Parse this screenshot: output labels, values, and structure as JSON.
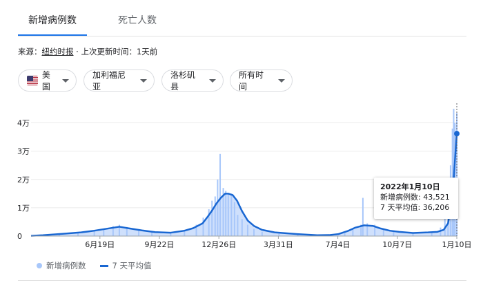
{
  "tabs": [
    {
      "label": "新增病例数",
      "active": true
    },
    {
      "label": "死亡人数",
      "active": false
    }
  ],
  "source": {
    "prefix": "来源：",
    "link": "纽约时报",
    "suffix": " · 上次更新时间：1天前"
  },
  "filters": {
    "country": "美国",
    "state": "加利福尼亚",
    "county": "洛杉矶县",
    "time": "所有时间"
  },
  "tooltip": {
    "date": "2022年1月10日",
    "new_cases": "新增病例数: 43,521",
    "avg": "7 天平均值: 36,206"
  },
  "legend": {
    "bars": "新增病例数",
    "line": "7 天平均值"
  },
  "colors": {
    "accent": "#1a73e8",
    "bars": "#a8c7fa",
    "line": "#1967d2"
  },
  "chart_data": {
    "type": "bar",
    "y_tick_labels": [
      "0",
      "1万",
      "2万",
      "3万",
      "4万"
    ],
    "x_tick_labels": [
      "6月19日",
      "9月22日",
      "12月26日",
      "3月31日",
      "7月4日",
      "10月7日",
      "1月10日"
    ],
    "ylim": [
      0,
      45000
    ],
    "series": [
      {
        "name": "新增病例数",
        "type": "bar",
        "x": [
          "2020-03-15",
          "2020-04-15",
          "2020-05-15",
          "2020-06-10",
          "2020-06-25",
          "2020-07-10",
          "2020-07-20",
          "2020-08-01",
          "2020-08-20",
          "2020-09-10",
          "2020-10-10",
          "2020-11-01",
          "2020-11-20",
          "2020-12-01",
          "2020-12-10",
          "2020-12-15",
          "2020-12-20",
          "2020-12-24",
          "2020-12-28",
          "2021-01-02",
          "2021-01-06",
          "2021-01-10",
          "2021-01-15",
          "2021-01-20",
          "2021-01-25",
          "2021-02-01",
          "2021-02-10",
          "2021-02-20",
          "2021-03-05",
          "2021-04-01",
          "2021-05-01",
          "2021-06-01",
          "2021-06-25",
          "2021-07-15",
          "2021-07-28",
          "2021-08-10",
          "2021-08-13",
          "2021-08-20",
          "2021-09-01",
          "2021-09-15",
          "2021-10-01",
          "2021-11-01",
          "2021-12-01",
          "2021-12-15",
          "2021-12-22",
          "2021-12-27",
          "2021-12-31",
          "2022-01-03",
          "2022-01-05",
          "2022-01-07",
          "2022-01-10"
        ],
        "values": [
          300,
          800,
          1200,
          1800,
          2500,
          3500,
          4000,
          3200,
          2300,
          1500,
          1300,
          2200,
          4000,
          6500,
          9500,
          12500,
          14000,
          20000,
          29000,
          17000,
          16000,
          15000,
          15000,
          12000,
          7500,
          6000,
          4000,
          2500,
          1500,
          800,
          500,
          300,
          400,
          1000,
          2500,
          4000,
          13500,
          4500,
          4000,
          2500,
          1800,
          1200,
          1500,
          3000,
          7000,
          17000,
          25000,
          38000,
          45000,
          40000,
          43521
        ]
      },
      {
        "name": "7 天平均值",
        "type": "line",
        "x": [
          "2020-03-01",
          "2020-03-20",
          "2020-04-20",
          "2020-05-20",
          "2020-06-10",
          "2020-06-30",
          "2020-07-20",
          "2020-08-05",
          "2020-08-25",
          "2020-09-15",
          "2020-10-10",
          "2020-11-01",
          "2020-11-15",
          "2020-11-30",
          "2020-12-08",
          "2020-12-15",
          "2020-12-22",
          "2020-12-29",
          "2021-01-05",
          "2021-01-10",
          "2021-01-17",
          "2021-01-24",
          "2021-02-01",
          "2021-02-10",
          "2021-02-20",
          "2021-03-05",
          "2021-03-25",
          "2021-04-30",
          "2021-06-01",
          "2021-06-20",
          "2021-07-05",
          "2021-07-20",
          "2021-08-01",
          "2021-08-15",
          "2021-08-29",
          "2021-09-10",
          "2021-09-25",
          "2021-10-10",
          "2021-11-01",
          "2021-11-25",
          "2021-12-10",
          "2021-12-20",
          "2021-12-27",
          "2022-01-01",
          "2022-01-05",
          "2022-01-08",
          "2022-01-10"
        ],
        "values": [
          100,
          300,
          800,
          1300,
          1900,
          2600,
          3300,
          2700,
          2000,
          1400,
          1200,
          1900,
          2800,
          4500,
          6800,
          9000,
          11500,
          13500,
          15000,
          15000,
          14500,
          12500,
          8800,
          5500,
          3600,
          2200,
          1300,
          700,
          300,
          350,
          700,
          1800,
          3000,
          3800,
          3600,
          2700,
          1900,
          1500,
          1100,
          1300,
          1500,
          2200,
          4500,
          11000,
          20000,
          30000,
          36206
        ]
      }
    ]
  }
}
